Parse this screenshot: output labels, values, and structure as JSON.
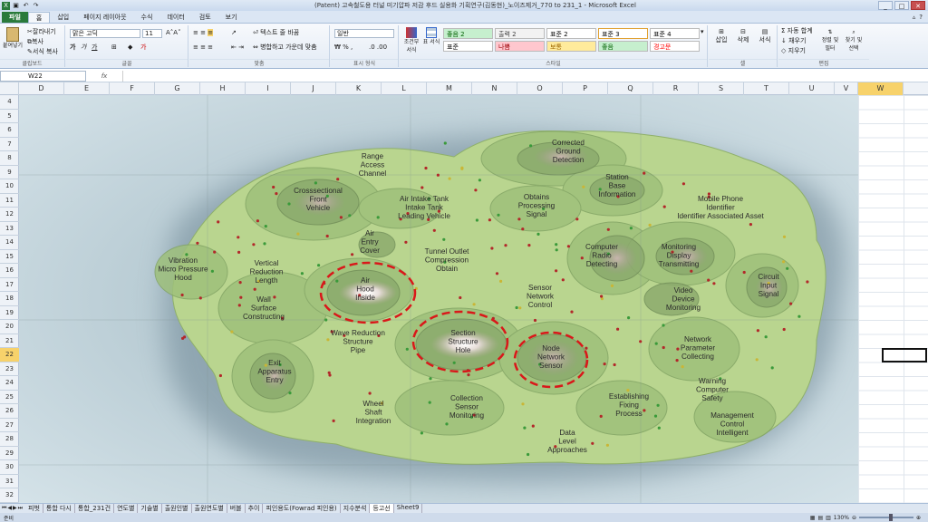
{
  "window": {
    "title": "(Patent) 고속철도용 터널 미기압파 저감 후드 실용화 기획연구(김동현)_노이즈제거_770 to 231_1 - Microsoft Excel",
    "controls": [
      "_",
      "□",
      "✕"
    ]
  },
  "tabs": [
    {
      "label": "파일",
      "kind": "file"
    },
    {
      "label": "홈",
      "kind": "active"
    },
    {
      "label": "삽입"
    },
    {
      "label": "페이지 레이아웃"
    },
    {
      "label": "수식"
    },
    {
      "label": "데이터"
    },
    {
      "label": "검토"
    },
    {
      "label": "보기"
    }
  ],
  "ribbon": {
    "clipboard": {
      "paste": "붙여넣기",
      "cut": "잘라내기",
      "copy": "복사",
      "format_painter": "서식 복사",
      "label": "클립보드"
    },
    "font": {
      "name": "맑은 고딕",
      "size": "11",
      "label": "글꼴"
    },
    "alignment": {
      "wrap": "텍스트 줄 바꿈",
      "merge": "병합하고 가운데 맞춤",
      "label": "맞춤"
    },
    "number": {
      "format": "일반",
      "label": "표시 형식"
    },
    "styles": {
      "conditional": "조건부 서식",
      "table": "표 서식",
      "cells": [
        {
          "label": "좋음 2",
          "bg": "#c6efce",
          "fg": "#006100"
        },
        {
          "label": "출력 2",
          "bg": "#f2f2f2",
          "fg": "#3f3f3f"
        },
        {
          "label": "표준 2",
          "bg": "#ffffff",
          "fg": "#000000"
        },
        {
          "label": "표준 3",
          "bg": "#ffffff",
          "fg": "#000000"
        },
        {
          "label": "표준 4",
          "bg": "#ffffff",
          "fg": "#000000"
        },
        {
          "label": "표준",
          "bg": "#ffffff",
          "fg": "#000000"
        },
        {
          "label": "나쁨",
          "bg": "#ffc7ce",
          "fg": "#9c0006"
        },
        {
          "label": "보통",
          "bg": "#ffeb9c",
          "fg": "#9c6500"
        },
        {
          "label": "좋음",
          "bg": "#c6efce",
          "fg": "#006100"
        },
        {
          "label": "경고문",
          "bg": "#ffffff",
          "fg": "#ff0000"
        }
      ],
      "label": "스타일"
    },
    "cells": {
      "insert": "삽입",
      "delete": "삭제",
      "format": "서식",
      "label": "셀"
    },
    "editing": {
      "autosum": "자동 합계",
      "fill": "채우기",
      "clear": "지우기",
      "sort": "정렬 및 필터",
      "find": "찾기 및 선택",
      "label": "편집"
    }
  },
  "formula_bar": {
    "name_box": "W22",
    "fx": "fx",
    "value": ""
  },
  "columns": [
    "D",
    "E",
    "F",
    "G",
    "H",
    "I",
    "J",
    "K",
    "L",
    "M",
    "N",
    "O",
    "P",
    "Q",
    "R",
    "S",
    "T",
    "U",
    "V",
    "W"
  ],
  "selected_column": "W",
  "rows": [
    "4",
    "5",
    "6",
    "7",
    "8",
    "9",
    "10",
    "11",
    "12",
    "13",
    "14",
    "15",
    "16",
    "17",
    "18",
    "19",
    "20",
    "21",
    "22",
    "23",
    "24",
    "25",
    "26",
    "27",
    "28",
    "29",
    "30",
    "31",
    "32"
  ],
  "selected_row": "22",
  "map": {
    "labels": [
      {
        "text": "Corrected\nGround\nDetection"
      },
      {
        "text": "Range\nAccess\nChannel"
      },
      {
        "text": "Crosssectional\nFront\nVehicle"
      },
      {
        "text": "Air Intake Tank\nIntake Tank\nLeading Vehicle"
      },
      {
        "text": "Obtains\nProcessing\nSignal"
      },
      {
        "text": "Station\nBase\nInformation"
      },
      {
        "text": "Mobile Phone\nIdentifier\nIdentifier Associated Asset"
      },
      {
        "text": "Air\nEntry\nCover"
      },
      {
        "text": "Tunnel Outlet\nCompression\nObtain"
      },
      {
        "text": "Computer\nRadio\nDetecting"
      },
      {
        "text": "Monitoring\nDisplay\nTransmitting"
      },
      {
        "text": "Vibration\nMicro Pressure\nHood"
      },
      {
        "text": "Vertical\nReduction\nLength"
      },
      {
        "text": "Air\nHood\nInside"
      },
      {
        "text": "Sensor\nNetwork\nControl"
      },
      {
        "text": "Video\nDevice\nMonitoring"
      },
      {
        "text": "Circuit\nInput\nSignal"
      },
      {
        "text": "Wall\nSurface\nConstructing"
      },
      {
        "text": "Wave Reduction\nStructure\nPipe"
      },
      {
        "text": "Section\nStructure\nHole"
      },
      {
        "text": "Node\nNetwork\nSensor"
      },
      {
        "text": "Network\nParameter\nCollecting"
      },
      {
        "text": "Exit\nApparatus\nEntry"
      },
      {
        "text": "Warning\nComputer\nSafety"
      },
      {
        "text": "Establishing\nFixing\nProcess"
      },
      {
        "text": "Wheel\nShaft\nIntegration"
      },
      {
        "text": "Collection\nSensor\nMonitoring"
      },
      {
        "text": "Management\nControl\nIntelligent"
      },
      {
        "text": "Data\nLevel\nApproaches"
      }
    ],
    "highlight_color": "#d9181a"
  },
  "sheet_tabs": [
    "피벗",
    "통합 다시",
    "통합_231건",
    "연도별",
    "기술별",
    "출원인별",
    "출원연도별",
    "버블",
    "추이",
    "피인용도(Fowrad 피인용)",
    "지수분석",
    "등고선",
    "Sheet9"
  ],
  "active_sheet": "등고선",
  "status": {
    "ready": "준비",
    "zoom": "130%"
  }
}
